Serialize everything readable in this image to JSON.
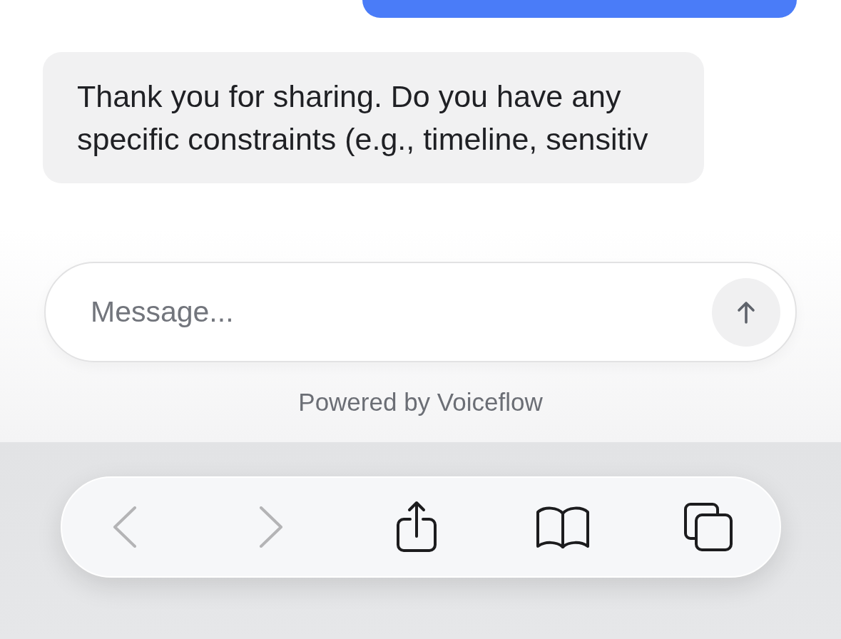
{
  "messages": [
    {
      "kind": "user"
    },
    {
      "kind": "assistant",
      "text": "Thank you for sharing. Do you have any specific constraints (e.g., timeline, sensitiv"
    }
  ],
  "composer": {
    "placeholder": "Message...",
    "send_button": {
      "disabled": true
    }
  },
  "branding": "Powered by Voiceflow",
  "browser_toolbar": {
    "buttons": [
      {
        "kind": "back",
        "disabled": true
      },
      {
        "kind": "forward",
        "disabled": true
      },
      {
        "kind": "share",
        "disabled": false
      },
      {
        "kind": "bookmarks",
        "disabled": false
      },
      {
        "kind": "tabs",
        "disabled": false
      }
    ]
  }
}
